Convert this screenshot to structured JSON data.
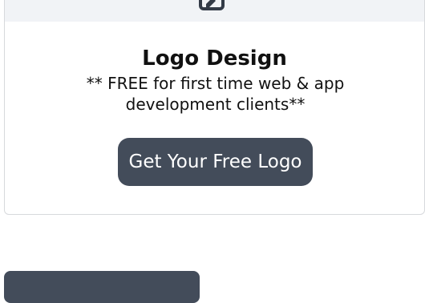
{
  "card": {
    "icon": "edit-document-icon",
    "title": "Logo Design",
    "subtitle": "** FREE for first time web & app development clients**",
    "cta_label": "Get Your Free Logo"
  },
  "colors": {
    "button_bg": "#434c5a",
    "card_header_bg": "#f1f3f6",
    "card_border": "#d7d9dc"
  }
}
